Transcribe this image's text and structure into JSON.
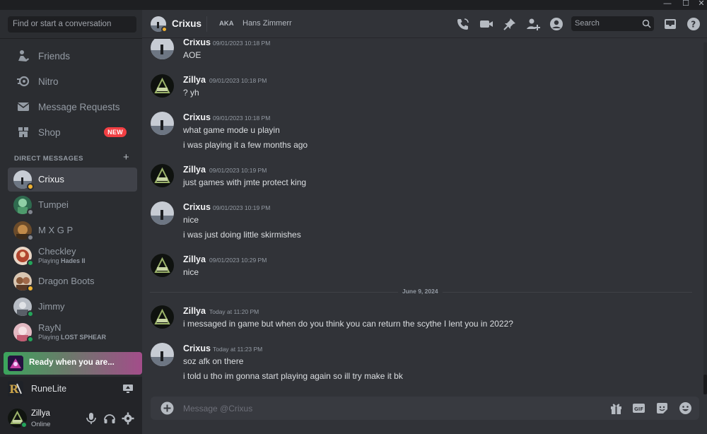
{
  "window": {
    "minimize": "—",
    "maximize": "☐",
    "close": "✕"
  },
  "sidebar": {
    "search_placeholder": "Find or start a conversation",
    "nav": [
      {
        "label": "Friends",
        "icon": "friends-icon"
      },
      {
        "label": "Nitro",
        "icon": "nitro-icon"
      },
      {
        "label": "Message Requests",
        "icon": "envelope-icon"
      },
      {
        "label": "Shop",
        "icon": "shop-icon",
        "badge": "NEW"
      }
    ],
    "dm_header": "DIRECT MESSAGES",
    "dm_add": "+",
    "dms": [
      {
        "name": "Crixus",
        "status": "idle",
        "active": true
      },
      {
        "name": "Tumpei",
        "status": "offline"
      },
      {
        "name": "M X G P",
        "status": "offline"
      },
      {
        "name": "Checkley",
        "status": "online",
        "activity_prefix": "Playing",
        "activity": "Hades II"
      },
      {
        "name": "Dragon Boots",
        "status": "idle"
      },
      {
        "name": "Jimmy",
        "status": "online"
      },
      {
        "name": "RayN",
        "status": "online",
        "activity_prefix": "Playing",
        "activity": "LOST SPHEAR"
      }
    ],
    "promo": {
      "text": "Ready when you are..."
    },
    "activity": {
      "name": "RuneLite"
    },
    "user": {
      "name": "Zillya",
      "status": "Online"
    }
  },
  "header": {
    "name": "Crixus",
    "aka_label": "AKA",
    "aka_name": "Hans Zimmerr",
    "search_placeholder": "Search"
  },
  "messages": [
    {
      "author": "Crixus",
      "avatar": "crixus",
      "time": "09/01/2023 10:18 PM",
      "lines": [
        "AOE"
      ]
    },
    {
      "author": "Zillya",
      "avatar": "zillya",
      "time": "09/01/2023 10:18 PM",
      "lines": [
        "? yh"
      ]
    },
    {
      "author": "Crixus",
      "avatar": "crixus",
      "time": "09/01/2023 10:18 PM",
      "lines": [
        "what game mode u playin",
        "i was playing it a few months ago"
      ]
    },
    {
      "author": "Zillya",
      "avatar": "zillya",
      "time": "09/01/2023 10:19 PM",
      "lines": [
        "just games with jmte protect king"
      ]
    },
    {
      "author": "Crixus",
      "avatar": "crixus",
      "time": "09/01/2023 10:19 PM",
      "lines": [
        "nice",
        "i was just doing little skirmishes"
      ]
    },
    {
      "author": "Zillya",
      "avatar": "zillya",
      "time": "09/01/2023 10:29 PM",
      "lines": [
        "nice"
      ]
    },
    {
      "author": "Zillya",
      "avatar": "zillya",
      "time": "Today at 11:20 PM",
      "lines": [
        "i messaged in game but when do you think you can return the scythe I lent you in 2022?"
      ]
    },
    {
      "author": "Crixus",
      "avatar": "crixus",
      "time": "Today at 11:23 PM",
      "lines": [
        "soz afk on there",
        "i told u tho im gonna start playing again so ill try make it bk"
      ]
    }
  ],
  "date_divider": "June 9, 2024",
  "composer": {
    "placeholder": "Message @Crixus"
  },
  "colors": {
    "online": "#23a55a",
    "idle": "#f0b232",
    "offline": "#80848e",
    "danger": "#f23f43"
  }
}
